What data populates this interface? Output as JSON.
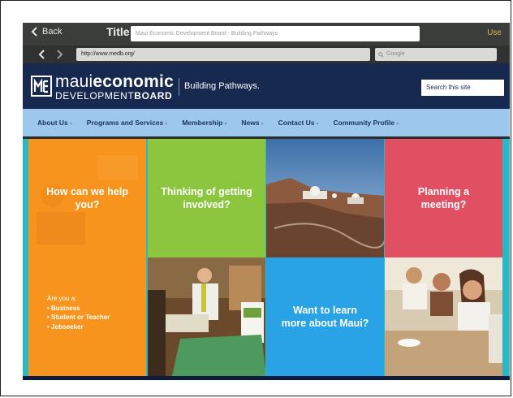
{
  "browser": {
    "back_label": "Back",
    "title_label": "Title",
    "title_value": "Maui Economic Development Board - Building Pathways",
    "use_label": "Use",
    "url": "http://www.medb.org/",
    "search_placeholder": "Google"
  },
  "site": {
    "logo_word1": "maui",
    "logo_word2": "economic",
    "logo_word3": "DEVELOPMENT",
    "logo_word4": "BOARD",
    "tagline": "Building Pathways.",
    "search_placeholder": "Search this site"
  },
  "nav": {
    "items": [
      {
        "label": "About Us"
      },
      {
        "label": "Programs and Services"
      },
      {
        "label": "Membership"
      },
      {
        "label": "News"
      },
      {
        "label": "Contact Us"
      },
      {
        "label": "Community Profile"
      }
    ]
  },
  "tiles": {
    "help": "How can we help you?",
    "involved": "Thinking of getting involved?",
    "meeting": "Planning a meeting?",
    "learn": "Want to learn more about Maui?",
    "areyou_lead": "Are you a:",
    "areyou_options": [
      "• Business",
      "• Student or Teacher",
      "• Jobseeker"
    ]
  },
  "colors": {
    "header_bg": "#17294f",
    "nav_bg": "#9ec7ed",
    "orange": "#f7941e",
    "green": "#8cc63f",
    "red": "#e15062",
    "blue": "#2aa3e6",
    "teal": "#2bb8c4"
  }
}
